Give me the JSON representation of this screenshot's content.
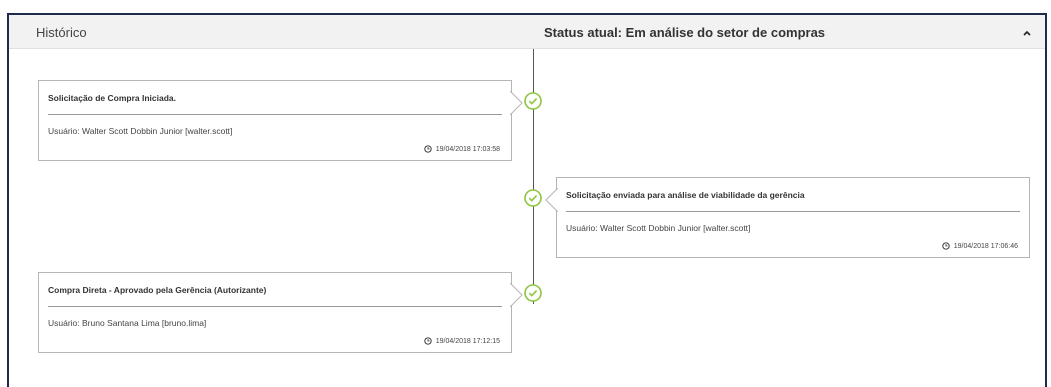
{
  "header": {
    "title": "Histórico",
    "status": "Status atual: Em análise do setor de compras"
  },
  "colors": {
    "panel_border": "#1f2a4d",
    "check_green": "#8cc63f",
    "header_bg": "#f2f2f2"
  },
  "timeline": [
    {
      "title": "Solicitação de Compra Iniciada.",
      "user": "Usuário: Walter Scott Dobbin Junior [walter.scott]",
      "time": "19/04/2018 17:03:58",
      "side": "left"
    },
    {
      "title": "Solicitação enviada para análise de viabilidade da gerência",
      "user": "Usuário: Walter Scott Dobbin Junior [walter.scott]",
      "time": "19/04/2018 17:06:46",
      "side": "right"
    },
    {
      "title": "Compra Direta - Aprovado pela Gerência (Autorizante)",
      "user": "Usuário: Bruno Santana Lima [bruno.lima]",
      "time": "19/04/2018 17:12:15",
      "side": "left"
    }
  ]
}
